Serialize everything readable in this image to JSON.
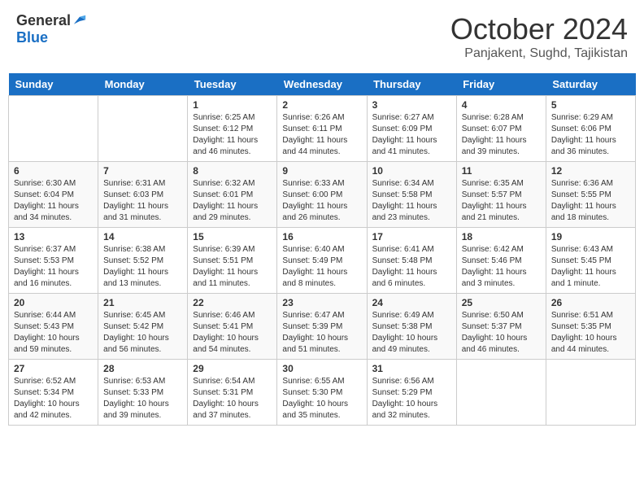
{
  "header": {
    "logo_general": "General",
    "logo_blue": "Blue",
    "title": "October 2024",
    "location": "Panjakent, Sughd, Tajikistan"
  },
  "days_of_week": [
    "Sunday",
    "Monday",
    "Tuesday",
    "Wednesday",
    "Thursday",
    "Friday",
    "Saturday"
  ],
  "weeks": [
    [
      {
        "day": "",
        "content": ""
      },
      {
        "day": "",
        "content": ""
      },
      {
        "day": "1",
        "content": "Sunrise: 6:25 AM\nSunset: 6:12 PM\nDaylight: 11 hours and 46 minutes."
      },
      {
        "day": "2",
        "content": "Sunrise: 6:26 AM\nSunset: 6:11 PM\nDaylight: 11 hours and 44 minutes."
      },
      {
        "day": "3",
        "content": "Sunrise: 6:27 AM\nSunset: 6:09 PM\nDaylight: 11 hours and 41 minutes."
      },
      {
        "day": "4",
        "content": "Sunrise: 6:28 AM\nSunset: 6:07 PM\nDaylight: 11 hours and 39 minutes."
      },
      {
        "day": "5",
        "content": "Sunrise: 6:29 AM\nSunset: 6:06 PM\nDaylight: 11 hours and 36 minutes."
      }
    ],
    [
      {
        "day": "6",
        "content": "Sunrise: 6:30 AM\nSunset: 6:04 PM\nDaylight: 11 hours and 34 minutes."
      },
      {
        "day": "7",
        "content": "Sunrise: 6:31 AM\nSunset: 6:03 PM\nDaylight: 11 hours and 31 minutes."
      },
      {
        "day": "8",
        "content": "Sunrise: 6:32 AM\nSunset: 6:01 PM\nDaylight: 11 hours and 29 minutes."
      },
      {
        "day": "9",
        "content": "Sunrise: 6:33 AM\nSunset: 6:00 PM\nDaylight: 11 hours and 26 minutes."
      },
      {
        "day": "10",
        "content": "Sunrise: 6:34 AM\nSunset: 5:58 PM\nDaylight: 11 hours and 23 minutes."
      },
      {
        "day": "11",
        "content": "Sunrise: 6:35 AM\nSunset: 5:57 PM\nDaylight: 11 hours and 21 minutes."
      },
      {
        "day": "12",
        "content": "Sunrise: 6:36 AM\nSunset: 5:55 PM\nDaylight: 11 hours and 18 minutes."
      }
    ],
    [
      {
        "day": "13",
        "content": "Sunrise: 6:37 AM\nSunset: 5:53 PM\nDaylight: 11 hours and 16 minutes."
      },
      {
        "day": "14",
        "content": "Sunrise: 6:38 AM\nSunset: 5:52 PM\nDaylight: 11 hours and 13 minutes."
      },
      {
        "day": "15",
        "content": "Sunrise: 6:39 AM\nSunset: 5:51 PM\nDaylight: 11 hours and 11 minutes."
      },
      {
        "day": "16",
        "content": "Sunrise: 6:40 AM\nSunset: 5:49 PM\nDaylight: 11 hours and 8 minutes."
      },
      {
        "day": "17",
        "content": "Sunrise: 6:41 AM\nSunset: 5:48 PM\nDaylight: 11 hours and 6 minutes."
      },
      {
        "day": "18",
        "content": "Sunrise: 6:42 AM\nSunset: 5:46 PM\nDaylight: 11 hours and 3 minutes."
      },
      {
        "day": "19",
        "content": "Sunrise: 6:43 AM\nSunset: 5:45 PM\nDaylight: 11 hours and 1 minute."
      }
    ],
    [
      {
        "day": "20",
        "content": "Sunrise: 6:44 AM\nSunset: 5:43 PM\nDaylight: 10 hours and 59 minutes."
      },
      {
        "day": "21",
        "content": "Sunrise: 6:45 AM\nSunset: 5:42 PM\nDaylight: 10 hours and 56 minutes."
      },
      {
        "day": "22",
        "content": "Sunrise: 6:46 AM\nSunset: 5:41 PM\nDaylight: 10 hours and 54 minutes."
      },
      {
        "day": "23",
        "content": "Sunrise: 6:47 AM\nSunset: 5:39 PM\nDaylight: 10 hours and 51 minutes."
      },
      {
        "day": "24",
        "content": "Sunrise: 6:49 AM\nSunset: 5:38 PM\nDaylight: 10 hours and 49 minutes."
      },
      {
        "day": "25",
        "content": "Sunrise: 6:50 AM\nSunset: 5:37 PM\nDaylight: 10 hours and 46 minutes."
      },
      {
        "day": "26",
        "content": "Sunrise: 6:51 AM\nSunset: 5:35 PM\nDaylight: 10 hours and 44 minutes."
      }
    ],
    [
      {
        "day": "27",
        "content": "Sunrise: 6:52 AM\nSunset: 5:34 PM\nDaylight: 10 hours and 42 minutes."
      },
      {
        "day": "28",
        "content": "Sunrise: 6:53 AM\nSunset: 5:33 PM\nDaylight: 10 hours and 39 minutes."
      },
      {
        "day": "29",
        "content": "Sunrise: 6:54 AM\nSunset: 5:31 PM\nDaylight: 10 hours and 37 minutes."
      },
      {
        "day": "30",
        "content": "Sunrise: 6:55 AM\nSunset: 5:30 PM\nDaylight: 10 hours and 35 minutes."
      },
      {
        "day": "31",
        "content": "Sunrise: 6:56 AM\nSunset: 5:29 PM\nDaylight: 10 hours and 32 minutes."
      },
      {
        "day": "",
        "content": ""
      },
      {
        "day": "",
        "content": ""
      }
    ]
  ]
}
